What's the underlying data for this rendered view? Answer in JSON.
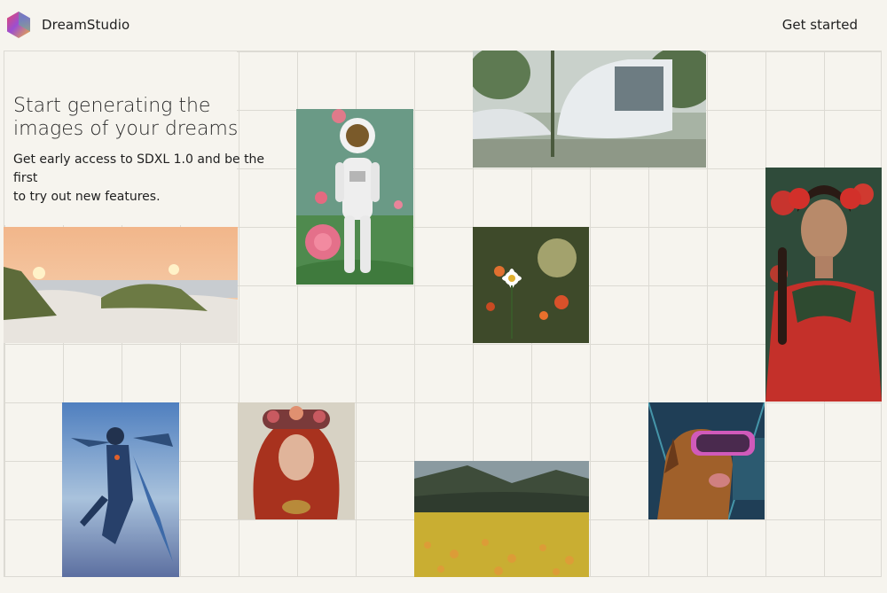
{
  "header": {
    "brand_name": "DreamStudio",
    "cta_label": "Get started"
  },
  "hero": {
    "title": "Start generating the images of your dreams",
    "subtitle_line1": "Get early access to SDXL 1.0 and be the first",
    "subtitle_line2": "to try out new features."
  },
  "colors": {
    "background": "#f6f4ee",
    "grid_line": "#dcdad3",
    "text": "#1f1f1f"
  }
}
